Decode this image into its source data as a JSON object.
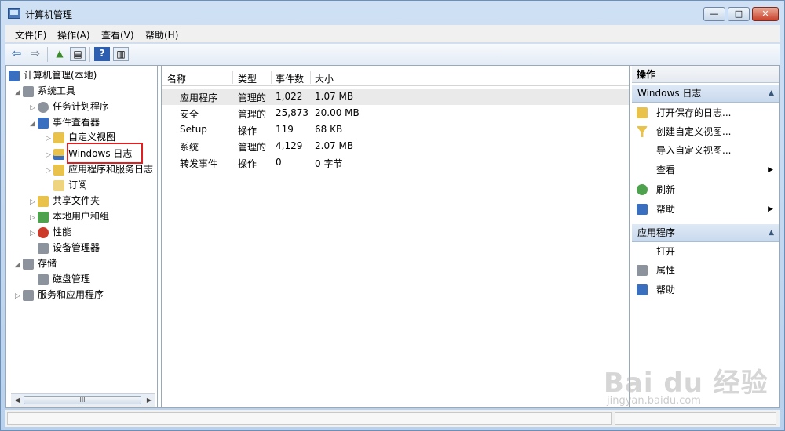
{
  "window": {
    "title": "计算机管理",
    "min_glyph": "—",
    "max_glyph": "□",
    "close_glyph": "✕"
  },
  "menu": [
    {
      "label": "文件(F)"
    },
    {
      "label": "操作(A)"
    },
    {
      "label": "查看(V)"
    },
    {
      "label": "帮助(H)"
    }
  ],
  "toolbar": {
    "buttons": [
      {
        "icon": "back-arrow-icon",
        "glyph": "⇦"
      },
      {
        "icon": "forward-arrow-icon",
        "glyph": "⇨"
      },
      {
        "icon": "up-folder-icon",
        "glyph": "▲"
      },
      {
        "icon": "show-tree-icon",
        "glyph": "▤"
      },
      {
        "icon": "help-icon",
        "glyph": "?"
      },
      {
        "icon": "show-action-pane-icon",
        "glyph": "▥"
      }
    ]
  },
  "tree": {
    "items": [
      {
        "label": "计算机管理(本地)",
        "icon": "computer-management-icon",
        "twisty": ""
      },
      {
        "label": "系统工具",
        "icon": "system-tools-icon",
        "twisty": "◢"
      },
      {
        "label": "任务计划程序",
        "icon": "task-scheduler-icon",
        "twisty": "▷"
      },
      {
        "label": "事件查看器",
        "icon": "event-viewer-icon",
        "twisty": "◢"
      },
      {
        "label": "自定义视图",
        "icon": "folder-icon",
        "twisty": "▷"
      },
      {
        "label": "Windows 日志",
        "icon": "windows-logs-icon",
        "twisty": "▷"
      },
      {
        "label": "应用程序和服务日志",
        "icon": "folder-icon",
        "twisty": "▷"
      },
      {
        "label": "订阅",
        "icon": "subscriptions-icon",
        "twisty": ""
      },
      {
        "label": "共享文件夹",
        "icon": "shared-folders-icon",
        "twisty": "▷"
      },
      {
        "label": "本地用户和组",
        "icon": "users-groups-icon",
        "twisty": "▷"
      },
      {
        "label": "性能",
        "icon": "performance-icon",
        "twisty": "▷"
      },
      {
        "label": "设备管理器",
        "icon": "device-manager-icon",
        "twisty": ""
      },
      {
        "label": "存储",
        "icon": "storage-icon",
        "twisty": "◢"
      },
      {
        "label": "磁盘管理",
        "icon": "disk-management-icon",
        "twisty": ""
      },
      {
        "label": "服务和应用程序",
        "icon": "services-apps-icon",
        "twisty": "▷"
      }
    ],
    "scroll_thumb": "III"
  },
  "list": {
    "columns": [
      "名称",
      "类型",
      "事件数",
      "大小"
    ],
    "rows": [
      [
        "应用程序",
        "管理的",
        "1,022",
        "1.07 MB"
      ],
      [
        "安全",
        "管理的",
        "25,873",
        "20.00 MB"
      ],
      [
        "Setup",
        "操作",
        "119",
        "68 KB"
      ],
      [
        "系统",
        "管理的",
        "4,129",
        "2.07 MB"
      ],
      [
        "转发事件",
        "操作",
        "0",
        "0 字节"
      ]
    ]
  },
  "actions": {
    "title": "操作",
    "sections": [
      {
        "title": "Windows 日志",
        "items": [
          {
            "label": "打开保存的日志...",
            "icon": "open-log-icon",
            "submenu": false
          },
          {
            "label": "创建自定义视图...",
            "icon": "filter-icon",
            "submenu": false
          },
          {
            "label": "导入自定义视图...",
            "icon": "",
            "submenu": false
          },
          {
            "label": "查看",
            "icon": "",
            "submenu": true
          },
          {
            "label": "刷新",
            "icon": "refresh-icon",
            "submenu": false
          },
          {
            "label": "帮助",
            "icon": "help-icon",
            "submenu": true
          }
        ]
      },
      {
        "title": "应用程序",
        "items": [
          {
            "label": "打开",
            "icon": "",
            "submenu": false
          },
          {
            "label": "属性",
            "icon": "properties-icon",
            "submenu": false
          },
          {
            "label": "帮助",
            "icon": "help-icon",
            "submenu": false
          }
        ]
      }
    ]
  },
  "watermark": {
    "main": "Bai du 经验",
    "sub": "jingyan.baidu.com"
  }
}
